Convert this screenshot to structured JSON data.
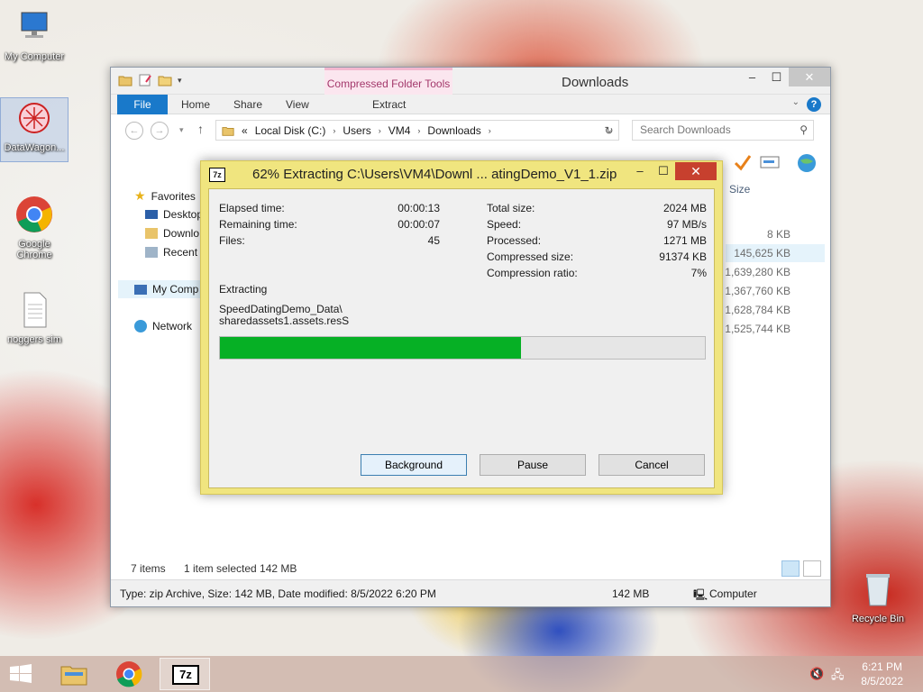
{
  "desktop": {
    "icons": [
      {
        "label": "My Computer"
      },
      {
        "label": "DataWagon..."
      },
      {
        "label": "Google Chrome"
      },
      {
        "label": "noggers sim"
      },
      {
        "label": "Recycle Bin"
      }
    ]
  },
  "explorer": {
    "title": "Downloads",
    "context_tab_group": "Compressed Folder Tools",
    "tabs": [
      "File",
      "Home",
      "Share",
      "View",
      "Extract"
    ],
    "breadcrumb": [
      "Local Disk (C:)",
      "Users",
      "VM4",
      "Downloads"
    ],
    "breadcrumb_prefix": "«",
    "search_placeholder": "Search Downloads",
    "nav": {
      "favorites": "Favorites",
      "desktop": "Desktop",
      "downloads": "Downlo",
      "recent": "Recent p",
      "computer": "My Comp",
      "network": "Network"
    },
    "size_header": "Size",
    "sizes": [
      "8 KB",
      "145,625 KB",
      "1,639,280 KB",
      "1,367,760 KB",
      "1,628,784 KB",
      "1,525,744 KB"
    ],
    "status_items": "7 items",
    "status_selected": "1 item selected  142 MB",
    "details": "Type: zip Archive, Size: 142 MB, Date modified: 8/5/2022 6:20 PM",
    "details_size": "142 MB",
    "details_location": "Computer"
  },
  "dialog": {
    "title": "62% Extracting C:\\Users\\VM4\\Downl ... atingDemo_V1_1.zip",
    "icon_text": "7z",
    "left": [
      {
        "label": "Elapsed time:",
        "value": "00:00:13"
      },
      {
        "label": "Remaining time:",
        "value": "00:00:07"
      },
      {
        "label": "Files:",
        "value": "45"
      }
    ],
    "right": [
      {
        "label": "Total size:",
        "value": "2024 MB"
      },
      {
        "label": "Speed:",
        "value": "97 MB/s"
      },
      {
        "label": "Processed:",
        "value": "1271 MB"
      },
      {
        "label": "Compressed size:",
        "value": "91374 KB"
      },
      {
        "label": "Compression ratio:",
        "value": "7%"
      }
    ],
    "status": "Extracting",
    "file_line1": "SpeedDatingDemo_Data\\",
    "file_line2": "sharedassets1.assets.resS",
    "progress": 0.62,
    "buttons": {
      "background": "Background",
      "pause": "Pause",
      "cancel": "Cancel"
    }
  },
  "taskbar": {
    "time": "6:21 PM",
    "date": "8/5/2022",
    "sevenzip_label": "7z"
  }
}
